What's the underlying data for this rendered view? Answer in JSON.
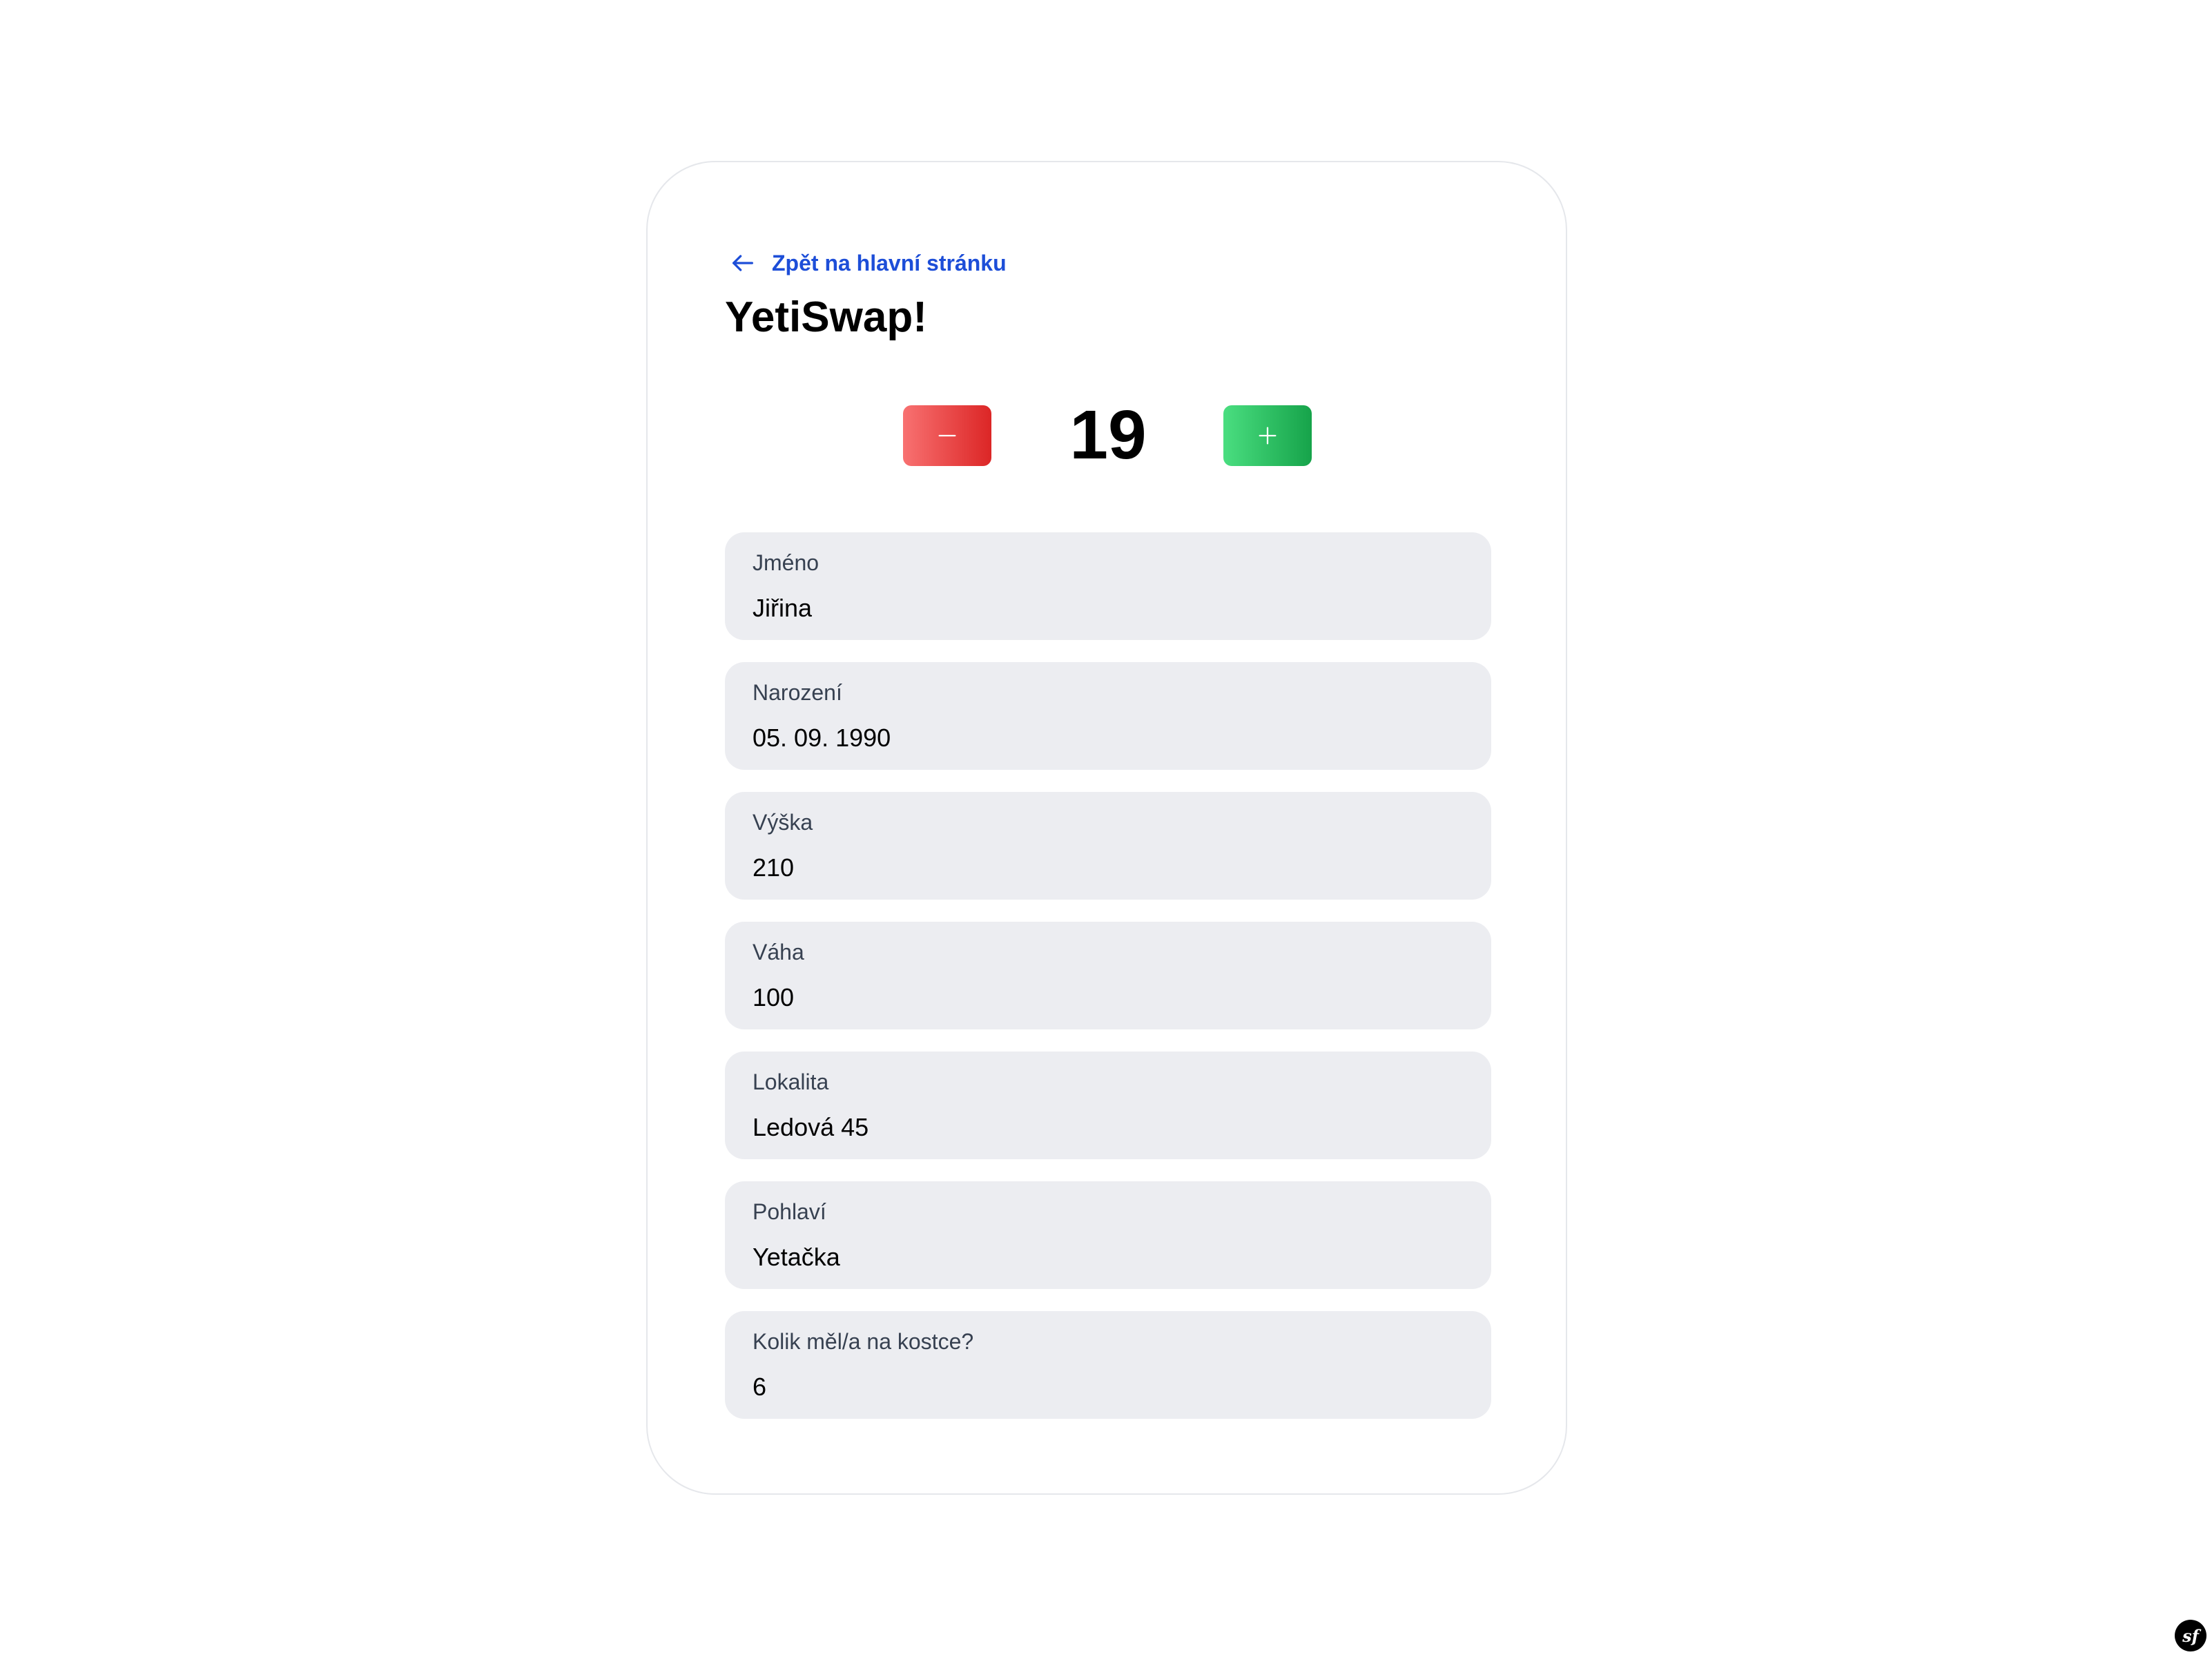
{
  "nav": {
    "back_label": "Zpět na hlavní stránku"
  },
  "page": {
    "title": "YetiSwap!"
  },
  "counter": {
    "value": "19",
    "decrement_icon": "minus-icon",
    "increment_icon": "plus-icon"
  },
  "fields": [
    {
      "label": "Jméno",
      "value": "Jiřina"
    },
    {
      "label": "Narození",
      "value": "05. 09. 1990"
    },
    {
      "label": "Výška",
      "value": "210"
    },
    {
      "label": "Váha",
      "value": "100"
    },
    {
      "label": "Lokalita",
      "value": "Ledová 45"
    },
    {
      "label": "Pohlaví",
      "value": "Yetačka"
    },
    {
      "label": "Kolik měl/a na kostce?",
      "value": "6"
    }
  ],
  "footer": {
    "logo_text": "sf"
  },
  "colors": {
    "link": "#1d4ed8",
    "minus_button": "#ef4444",
    "plus_button": "#22c55e",
    "field_background": "#ecedf1"
  }
}
